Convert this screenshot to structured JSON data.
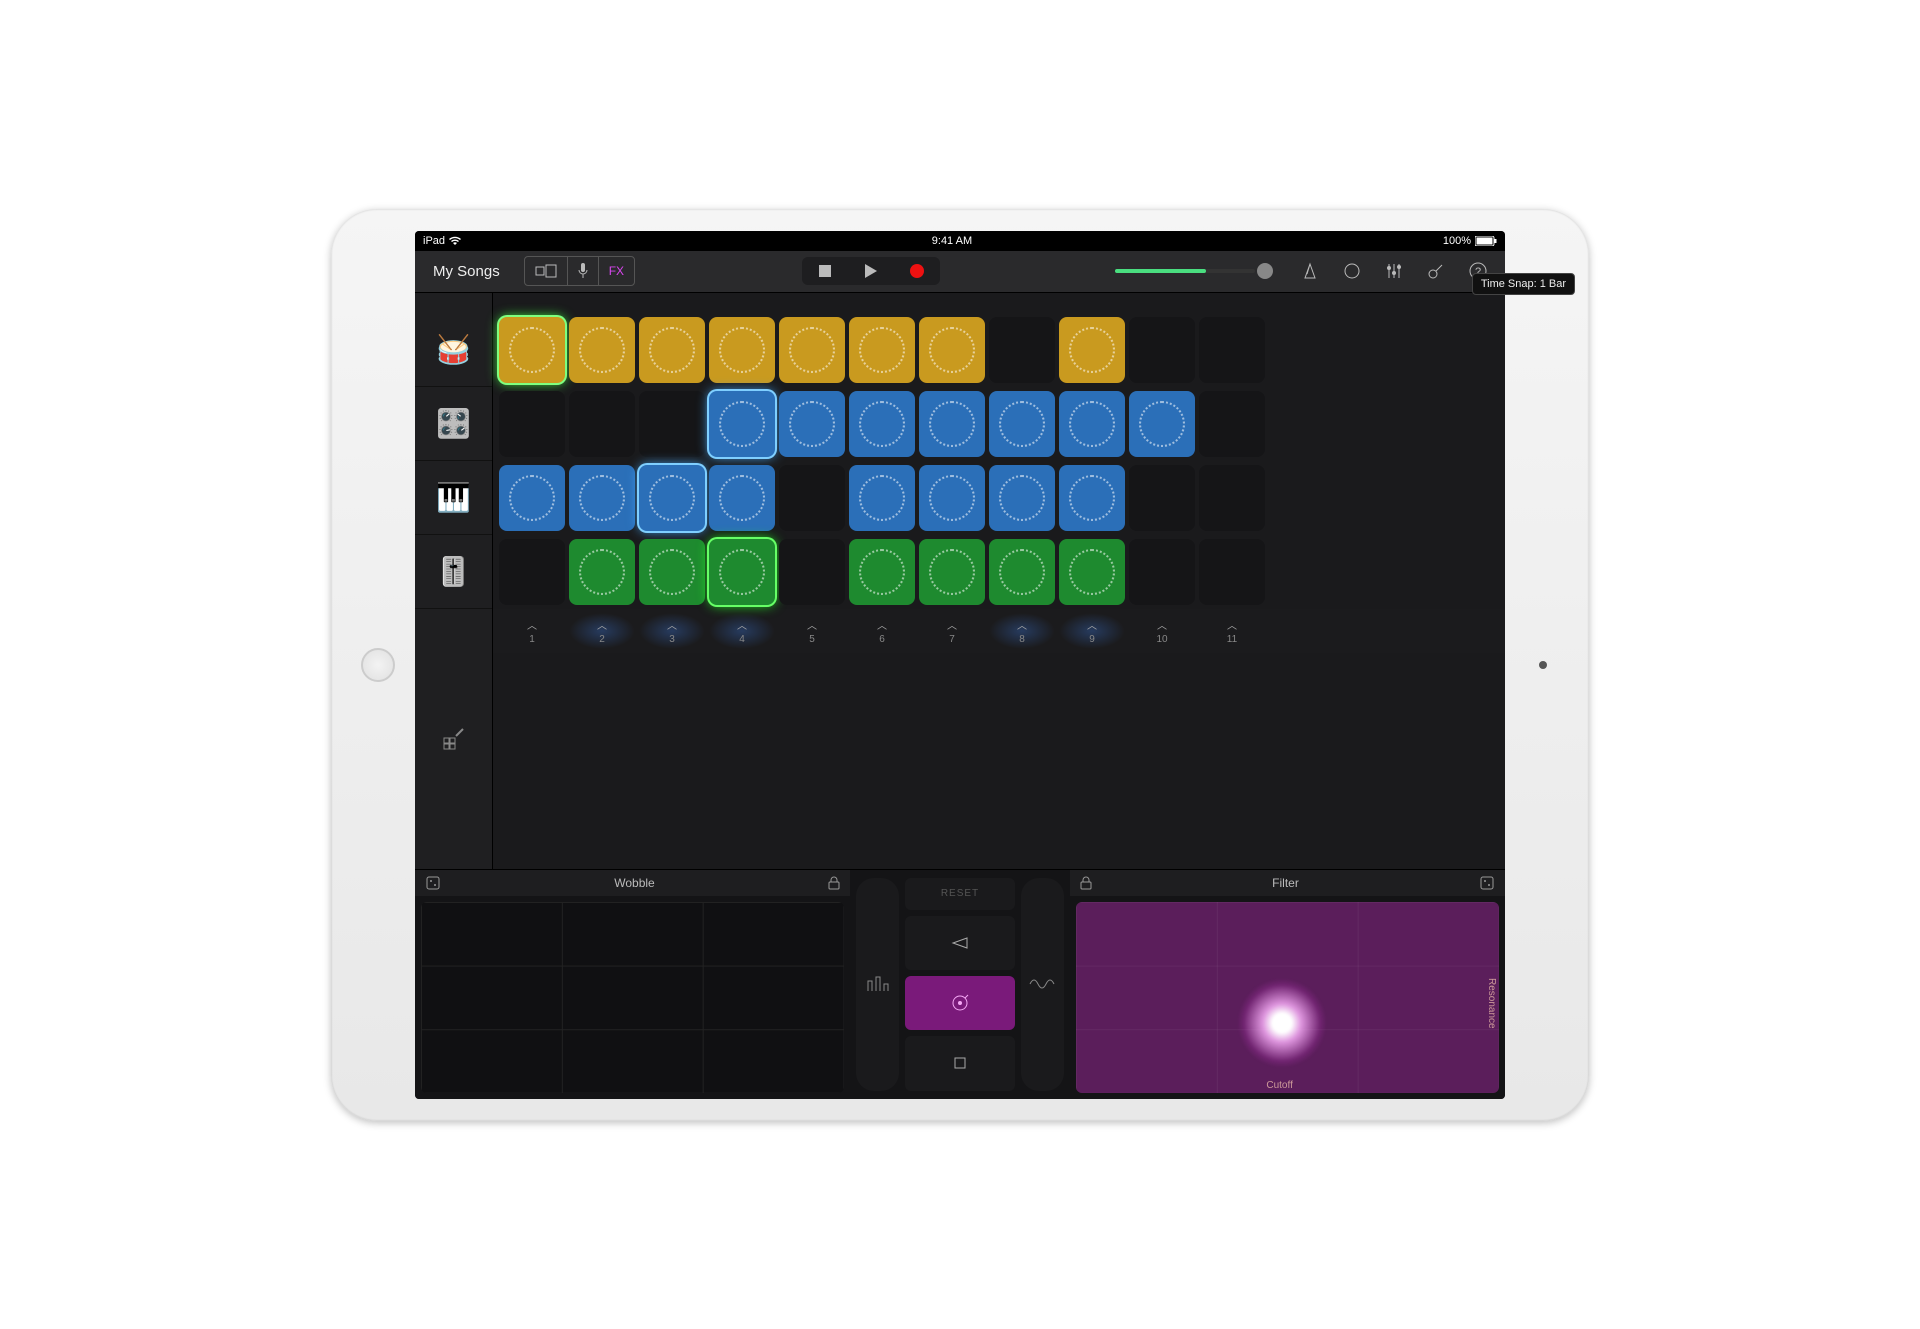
{
  "status": {
    "device": "iPad",
    "time": "9:41 AM",
    "battery": "100%"
  },
  "toolbar": {
    "back_label": "My Songs",
    "fx_label": "FX",
    "snap_label": "Time Snap: 1 Bar"
  },
  "tracks": [
    {
      "name": "drums",
      "icon": "drums-icon"
    },
    {
      "name": "sampler",
      "icon": "sampler-icon"
    },
    {
      "name": "keys",
      "icon": "keys-icon"
    },
    {
      "name": "synth",
      "icon": "synth-icon"
    }
  ],
  "grid": {
    "columns": 11,
    "rows": [
      {
        "color": "yellow",
        "filled": [
          0,
          1,
          2,
          3,
          4,
          5,
          6,
          8
        ],
        "active": 0
      },
      {
        "color": "blue",
        "filled": [
          3,
          4,
          5,
          6,
          7,
          8,
          9
        ],
        "active": 3
      },
      {
        "color": "blue",
        "filled": [
          0,
          1,
          2,
          3,
          5,
          6,
          7,
          8
        ],
        "active": 2
      },
      {
        "color": "green",
        "filled": [
          1,
          2,
          3,
          5,
          6,
          7,
          8
        ],
        "active": 3
      }
    ]
  },
  "triggers": {
    "labels": [
      "1",
      "2",
      "3",
      "4",
      "5",
      "6",
      "7",
      "8",
      "9",
      "10",
      "11"
    ],
    "glowing": [
      1,
      2,
      3,
      7,
      8
    ]
  },
  "fx": {
    "left": {
      "title": "Wobble"
    },
    "right": {
      "title": "Filter",
      "x_axis": "Cutoff",
      "y_axis": "Resonance"
    },
    "center": {
      "reset_label": "RESET",
      "buttons": [
        "reverse",
        "scratch",
        "stop"
      ]
    }
  }
}
